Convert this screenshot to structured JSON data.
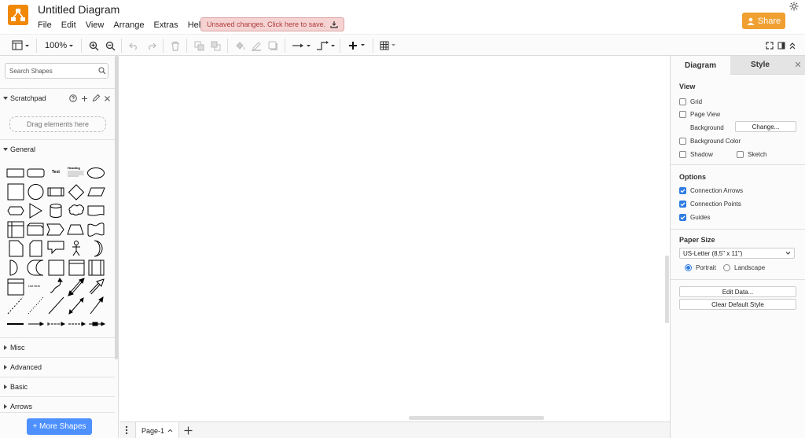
{
  "app": {
    "title": "Untitled Diagram",
    "logo": "drawio-logo",
    "accent_color": "#f08705"
  },
  "menu": [
    "File",
    "Edit",
    "View",
    "Arrange",
    "Extras",
    "Help"
  ],
  "unsaved_banner": {
    "text": "Unsaved changes. Click here to save.",
    "icon": "save-download-icon",
    "color": "#b03a3a"
  },
  "share": {
    "label": "Share",
    "icon": "user-icon",
    "color": "#f0a030"
  },
  "theme_icon": "sun-icon",
  "toolbar": {
    "zoom": "100%",
    "icons": [
      "view-panels-icon",
      "zoom-in-icon",
      "zoom-out-icon",
      "undo-icon",
      "redo-icon",
      "delete-icon",
      "to-front-icon",
      "to-back-icon",
      "fill-color-icon",
      "line-color-icon",
      "shadow-icon",
      "connection-arrow-icon",
      "waypoints-icon",
      "insert-plus-icon",
      "table-icon",
      "fullscreen-icon",
      "format-panel-icon",
      "collapse-icon"
    ]
  },
  "sidebar": {
    "search_placeholder": "Search Shapes",
    "scratchpad": {
      "label": "Scratchpad",
      "drop_hint": "Drag elements here"
    },
    "sections": {
      "general": "General",
      "misc": "Misc",
      "advanced": "Advanced",
      "basic": "Basic",
      "arrows": "Arrows"
    },
    "shape_labels": {
      "text": "Text",
      "heading": "Heading",
      "list_item": "List Item"
    },
    "more_shapes": "+ More Shapes"
  },
  "pages": {
    "current": "Page-1"
  },
  "panel": {
    "tabs": {
      "diagram": "Diagram",
      "style": "Style"
    },
    "view": {
      "heading": "View",
      "grid": "Grid",
      "page_view": "Page View",
      "background": "Background",
      "change": "Change...",
      "background_color": "Background Color",
      "shadow": "Shadow",
      "sketch": "Sketch",
      "checked": {
        "grid": false,
        "page_view": false,
        "background_color": false,
        "shadow": false,
        "sketch": false
      }
    },
    "options": {
      "heading": "Options",
      "connection_arrows": "Connection Arrows",
      "connection_points": "Connection Points",
      "guides": "Guides",
      "checked": {
        "connection_arrows": true,
        "connection_points": true,
        "guides": true
      }
    },
    "paper": {
      "heading": "Paper Size",
      "size": "US-Letter (8,5\" x 11\")",
      "portrait": "Portrait",
      "landscape": "Landscape",
      "orientation": "portrait"
    },
    "buttons": {
      "edit_data": "Edit Data...",
      "clear_style": "Clear Default Style"
    },
    "check_color": "#2f7ce3"
  }
}
